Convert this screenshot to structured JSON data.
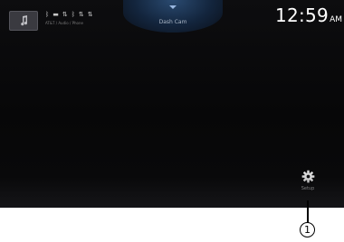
{
  "screen": {
    "thumbnail_icon": "music-note-icon",
    "status_icons": [
      "bluetooth-icon",
      "battery-icon",
      "signal-icon",
      "phone-icon",
      "signal-icon"
    ],
    "status_glyphs": [
      "ᛒ",
      "▬",
      "⇅",
      "ᛒ",
      "⇅",
      "⇅"
    ],
    "status_subtext": "AT&T / Audio / Phone",
    "dropdown_icon": "chevron-down-icon",
    "dropdown_label": "Dash Cam",
    "clock": {
      "time": "12:59",
      "ampm": "AM"
    },
    "setup_button": {
      "icon": "gear-icon",
      "label": "Setup"
    }
  },
  "callout": {
    "number": "1"
  },
  "colors": {
    "screen_bg": "#0a0a0b",
    "tab_accent": "#2a4a70",
    "text": "#ffffff"
  }
}
